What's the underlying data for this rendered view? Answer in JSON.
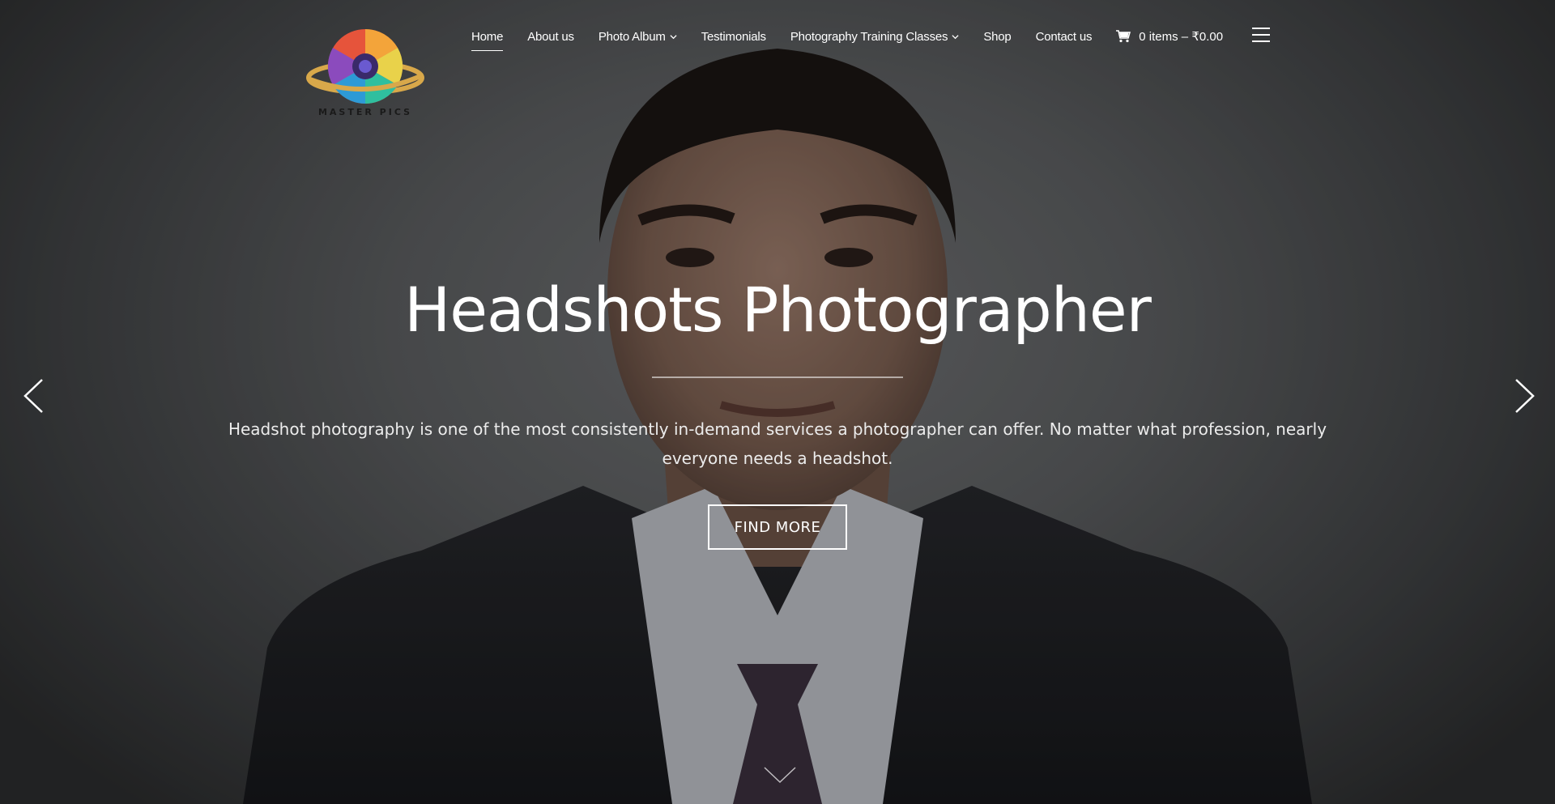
{
  "logo": {
    "text": "MASTER PICS"
  },
  "nav": {
    "items": [
      {
        "label": "Home",
        "has_dropdown": false,
        "active": true
      },
      {
        "label": "About us",
        "has_dropdown": false,
        "active": false
      },
      {
        "label": "Photo Album",
        "has_dropdown": true,
        "active": false
      },
      {
        "label": "Testimonials",
        "has_dropdown": false,
        "active": false
      },
      {
        "label": "Photography Training Classes",
        "has_dropdown": true,
        "active": false
      },
      {
        "label": "Shop",
        "has_dropdown": false,
        "active": false
      },
      {
        "label": "Contact us",
        "has_dropdown": false,
        "active": false
      }
    ],
    "cart_label": "0 items – ₹0.00"
  },
  "slide": {
    "title": "Headshots Photographer",
    "text": "Headshot photography is one of the most consistently in-demand services a photographer can offer. No matter what profession, nearly everyone needs a headshot.",
    "button_label": "FIND MORE"
  },
  "icons": {
    "prev": "chevron-left-icon",
    "next": "chevron-right-icon",
    "scroll": "chevron-down-icon",
    "menu": "hamburger-menu-icon",
    "cart": "shopping-cart-icon"
  }
}
